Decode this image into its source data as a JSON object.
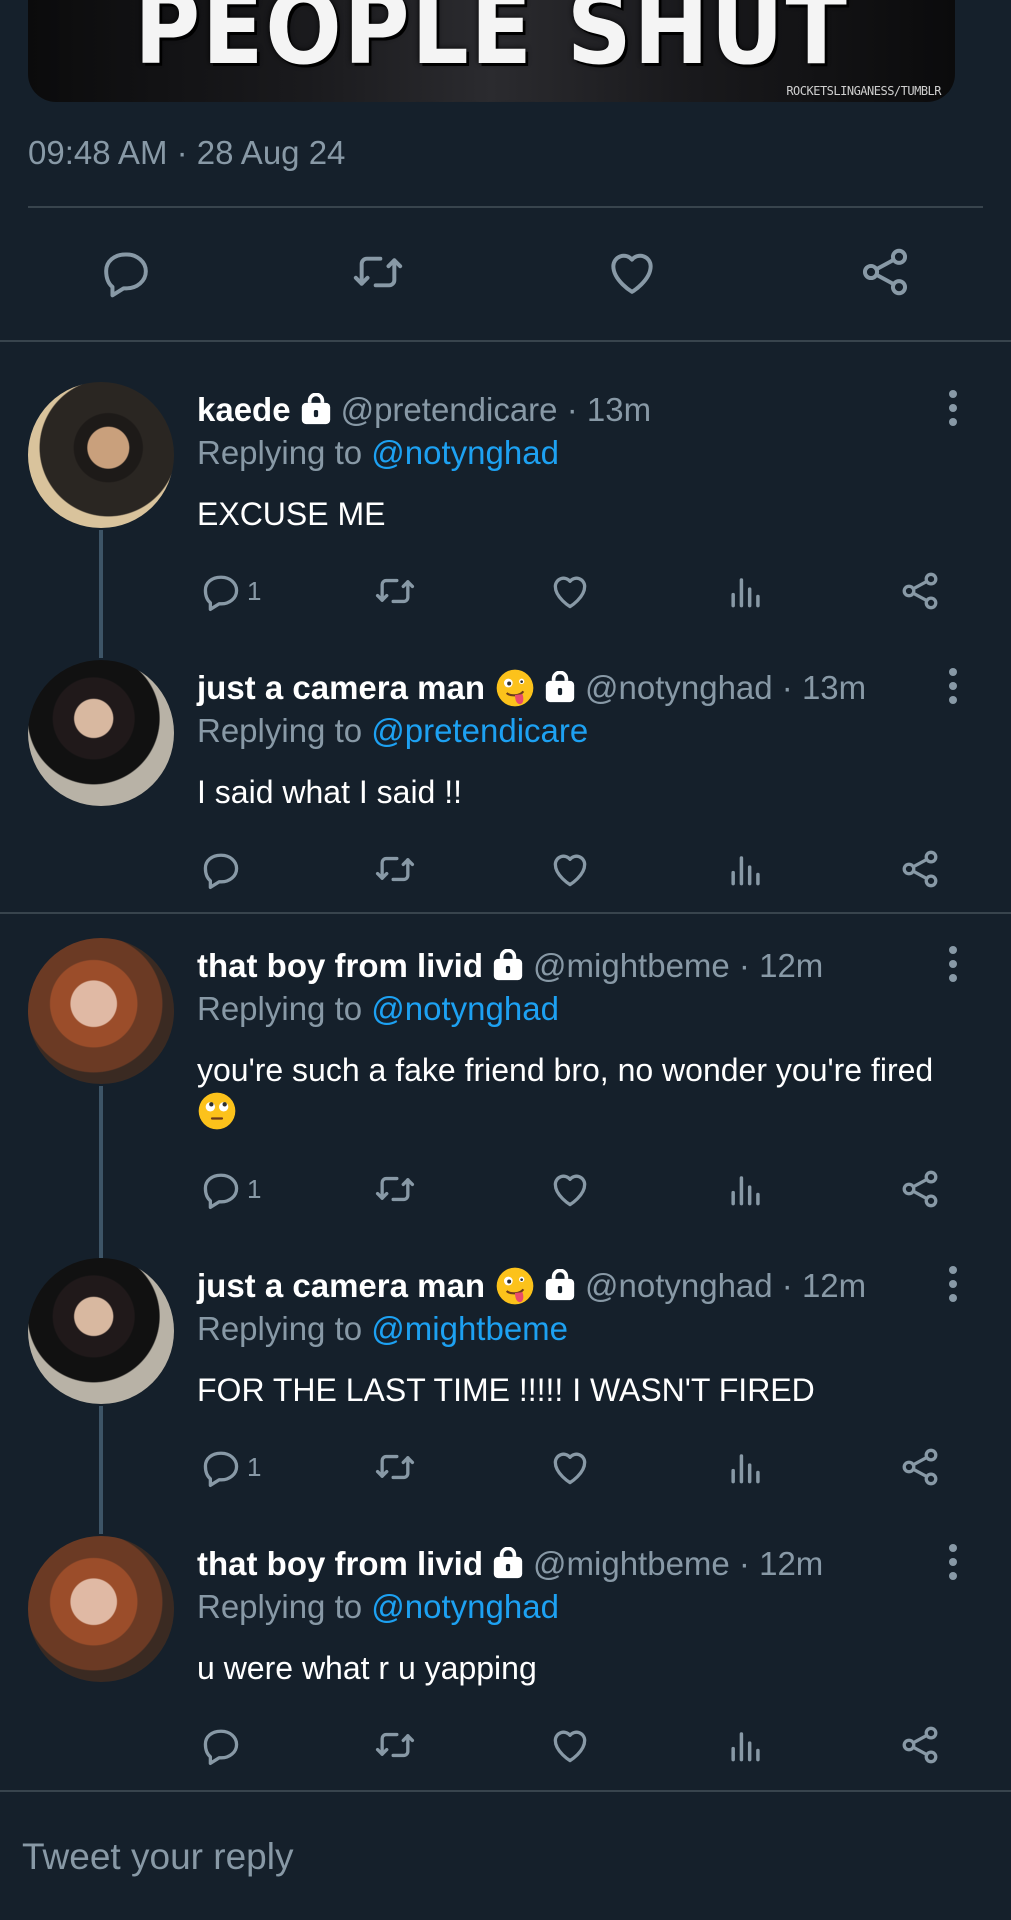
{
  "media": {
    "caption": "PEOPLE SHUT UP.",
    "credit": "ROCKETSLINGANESS/TUMBLR"
  },
  "main_tweet": {
    "timestamp": "09:48 AM · 28 Aug 24"
  },
  "replies": [
    {
      "name": "kaede",
      "handle": "@pretendicare",
      "time": "13m",
      "replying_to_label": "Replying to",
      "replying_to": "@notynghad",
      "text": "EXCUSE ME",
      "reply_count": "1",
      "has_emoji": false
    },
    {
      "name": "just a camera man",
      "handle": "@notynghad",
      "time": "13m",
      "replying_to_label": "Replying to",
      "replying_to": "@pretendicare",
      "text": "I said what I said !!",
      "reply_count": "",
      "has_emoji": true
    },
    {
      "name": "that boy from livid",
      "handle": "@mightbeme",
      "time": "12m",
      "replying_to_label": "Replying to",
      "replying_to": "@notynghad",
      "text": "you're such a fake friend bro, no wonder you're fired",
      "reply_count": "1",
      "has_emoji": false
    },
    {
      "name": "just a camera man",
      "handle": "@notynghad",
      "time": "12m",
      "replying_to_label": "Replying to",
      "replying_to": "@mightbeme",
      "text": "FOR THE LAST TIME !!!!! I WASN'T FIRED",
      "reply_count": "1",
      "has_emoji": true
    },
    {
      "name": "that boy from livid",
      "handle": "@mightbeme",
      "time": "12m",
      "replying_to_label": "Replying to",
      "replying_to": "@notynghad",
      "text": "u were what r u yapping",
      "reply_count": "",
      "has_emoji": false
    }
  ],
  "composer": {
    "placeholder": "Tweet your reply"
  },
  "colors": {
    "background": "#15202b",
    "secondary_text": "#8899a6",
    "accent": "#1da1f2",
    "divider": "#38444d"
  },
  "icons": [
    "reply-icon",
    "retweet-icon",
    "like-icon",
    "share-icon",
    "analytics-icon",
    "lock-icon",
    "more-icon",
    "zany-face-emoji",
    "eye-roll-emoji"
  ]
}
